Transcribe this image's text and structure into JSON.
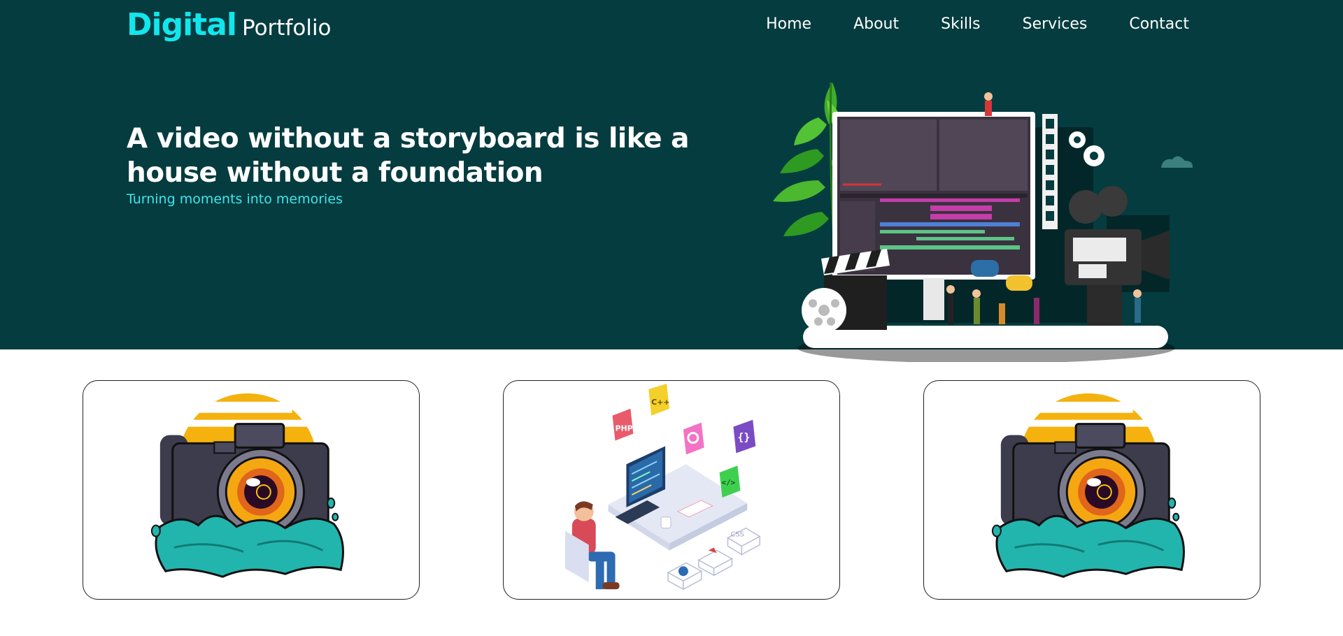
{
  "logo": {
    "bold": "Digital",
    "light": "Portfolio"
  },
  "nav": [
    {
      "label": "Home"
    },
    {
      "label": "About"
    },
    {
      "label": "Skills"
    },
    {
      "label": "Services"
    },
    {
      "label": "Contact"
    }
  ],
  "hero": {
    "headline": "A video without a storyboard is like a house without a foundation",
    "tagline": "Turning moments into memories"
  },
  "cards": [
    {
      "illustration": "camera-splash-illustration"
    },
    {
      "illustration": "developer-coding-illustration",
      "badges": [
        "C++",
        "PHP",
        "{}",
        "</>",
        "CSS"
      ]
    },
    {
      "illustration": "camera-splash-illustration"
    }
  ],
  "colors": {
    "hero_bg": "#053c3f",
    "accent": "#12e6ec",
    "tagline": "#3ee6ec",
    "text": "#ffffff"
  }
}
